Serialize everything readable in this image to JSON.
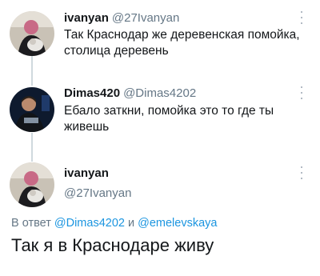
{
  "tweets": [
    {
      "name": "ivanyan",
      "handle": "@27Ivanyan",
      "lines": [
        "Так Краснодар же деревенская помойка,",
        "столица деревень"
      ]
    },
    {
      "name": "Dimas420",
      "handle": "@Dimas4202",
      "lines": [
        "Ебало заткни, помойка это то где ты",
        "живешь"
      ]
    }
  ],
  "main_tweet": {
    "name": "ivanyan",
    "handle": "@27Ivanyan",
    "reply_prefix": "В ответ",
    "reply_user_1": "@Dimas4202",
    "reply_conjunction": "и",
    "reply_user_2": "@emelevskaya",
    "text": "Так я в Краснодаре живу"
  },
  "colors": {
    "link": "#1b95e0",
    "secondary_text": "#657786",
    "thread_line": "#cfd9de"
  },
  "icons": [
    "more-vertical-icon"
  ]
}
